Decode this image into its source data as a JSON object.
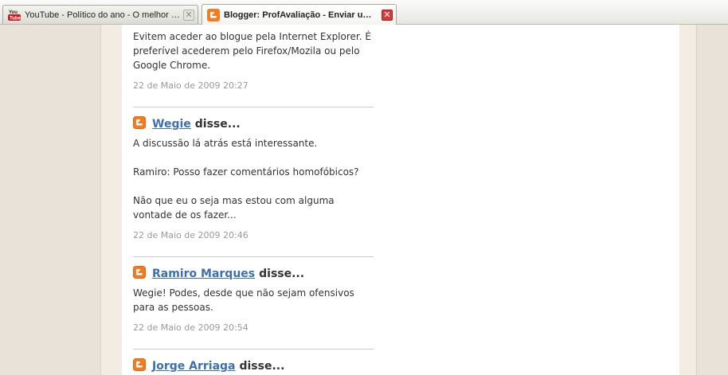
{
  "browser": {
    "tabs": [
      {
        "title": "YouTube - Político do ano - O melhor do...",
        "favicon": "youtube-icon",
        "active": false,
        "close_label": "✕"
      },
      {
        "title": "Blogger: ProfAvaliação - Enviar um comentário",
        "favicon": "blogger-icon",
        "active": true,
        "close_label": "✕"
      }
    ]
  },
  "theme": {
    "author_link_color": "#3d6fb0",
    "blogger_orange": "#f47c20",
    "close_active_color": "#d63a3a"
  },
  "comments": {
    "says_label": "disse...",
    "first": {
      "text": "Evitem aceder ao blogue pela Internet Explorer. É preferível acederem pelo Firefox/Mozila ou pelo Google Chrome.",
      "timestamp": "22 de Maio de 2009 20:27"
    },
    "items": [
      {
        "author": "Wegie",
        "paragraphs": [
          "A discussão lá atrás está interessante.",
          "Ramiro: Posso fazer comentários homofóbicos?",
          "Não que eu o seja mas estou com alguma vontade de os fazer..."
        ],
        "timestamp": "22 de Maio de 2009 20:46"
      },
      {
        "author": "Ramiro Marques",
        "paragraphs": [
          "Wegie! Podes, desde que não sejam ofensivos para as pessoas."
        ],
        "timestamp": "22 de Maio de 2009 20:54"
      },
      {
        "author": "Jorge Arriaga"
      }
    ]
  }
}
